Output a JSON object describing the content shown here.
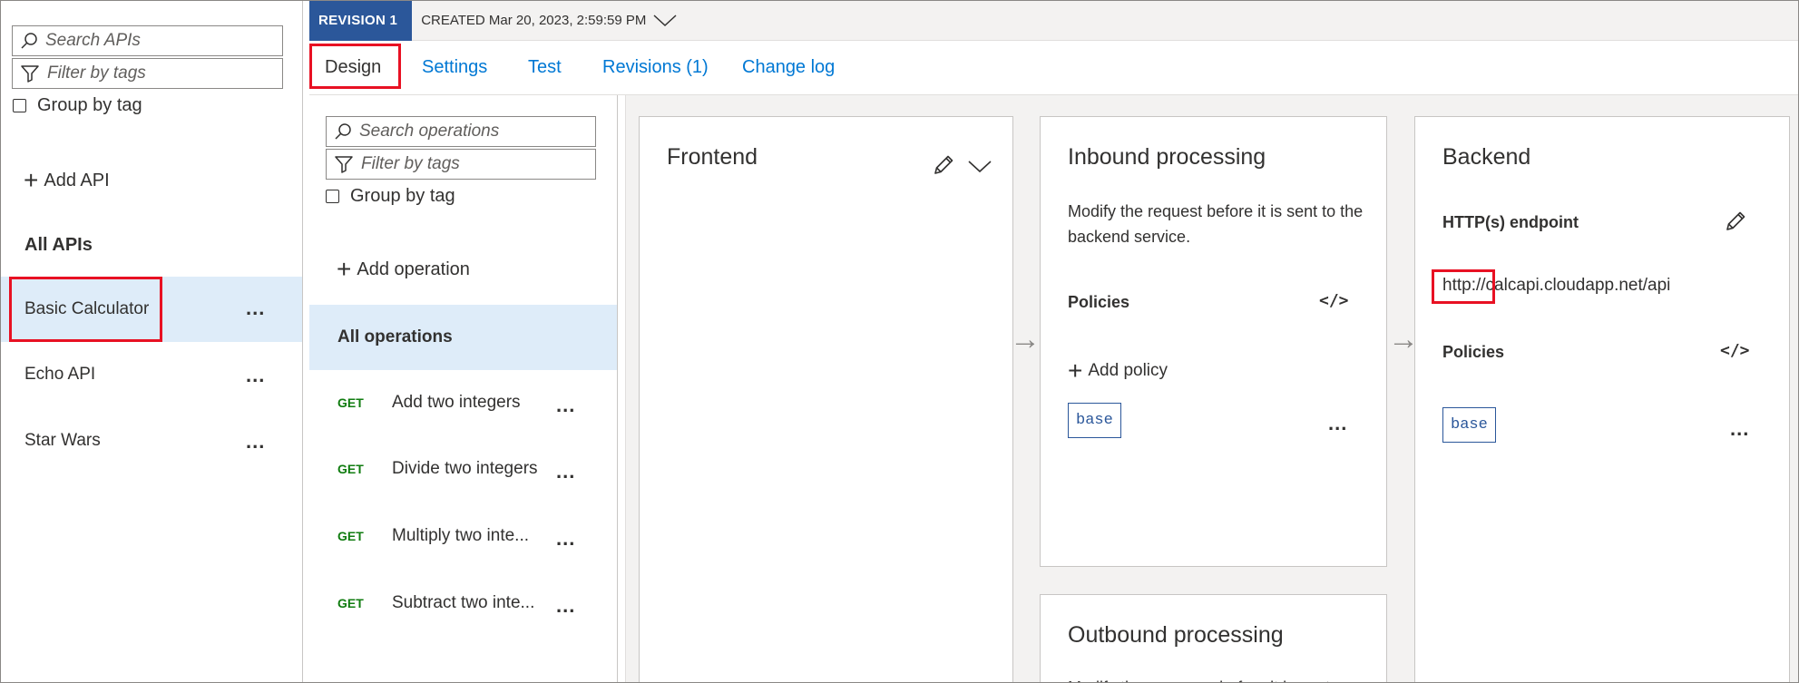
{
  "sidebar": {
    "search_placeholder": "Search APIs",
    "filter_placeholder": "Filter by tags",
    "group_by_tag_label": "Group by tag",
    "add_api_label": "Add API",
    "all_apis_label": "All APIs",
    "apis": [
      {
        "label": "Basic Calculator",
        "selected": true
      },
      {
        "label": "Echo API",
        "selected": false
      },
      {
        "label": "Star Wars",
        "selected": false
      }
    ],
    "more_label": "..."
  },
  "revision": {
    "badge": "REVISION 1",
    "created": "CREATED Mar 20, 2023, 2:59:59 PM"
  },
  "tabs": [
    {
      "label": "Design",
      "active": true
    },
    {
      "label": "Settings",
      "active": false
    },
    {
      "label": "Test",
      "active": false
    },
    {
      "label": "Revisions (1)",
      "active": false
    },
    {
      "label": "Change log",
      "active": false
    }
  ],
  "operations": {
    "search_placeholder": "Search operations",
    "filter_placeholder": "Filter by tags",
    "group_by_tag_label": "Group by tag",
    "add_operation_label": "Add operation",
    "all_operations_label": "All operations",
    "items": [
      {
        "method": "GET",
        "name": "Add two integers"
      },
      {
        "method": "GET",
        "name": "Divide two integers"
      },
      {
        "method": "GET",
        "name": "Multiply two inte..."
      },
      {
        "method": "GET",
        "name": "Subtract two inte..."
      }
    ]
  },
  "frontend": {
    "title": "Frontend"
  },
  "inbound": {
    "title": "Inbound processing",
    "description": "Modify the request before it is sent to the backend service.",
    "policies_label": "Policies",
    "add_policy_label": "Add policy",
    "policy_tag": "base"
  },
  "outbound": {
    "title": "Outbound processing",
    "description_partial": "Modify the response before it is sent"
  },
  "backend": {
    "title": "Backend",
    "endpoint_label": "HTTP(s) endpoint",
    "endpoint_url": "http://calcapi.cloudapp.net/api",
    "policies_label": "Policies",
    "policy_tag": "base"
  },
  "colors": {
    "accent": "#0078d4",
    "revision_badge": "#2b579a",
    "selected_bg": "#deecf9",
    "highlight": "#e81123",
    "method_get": "#107c10"
  }
}
